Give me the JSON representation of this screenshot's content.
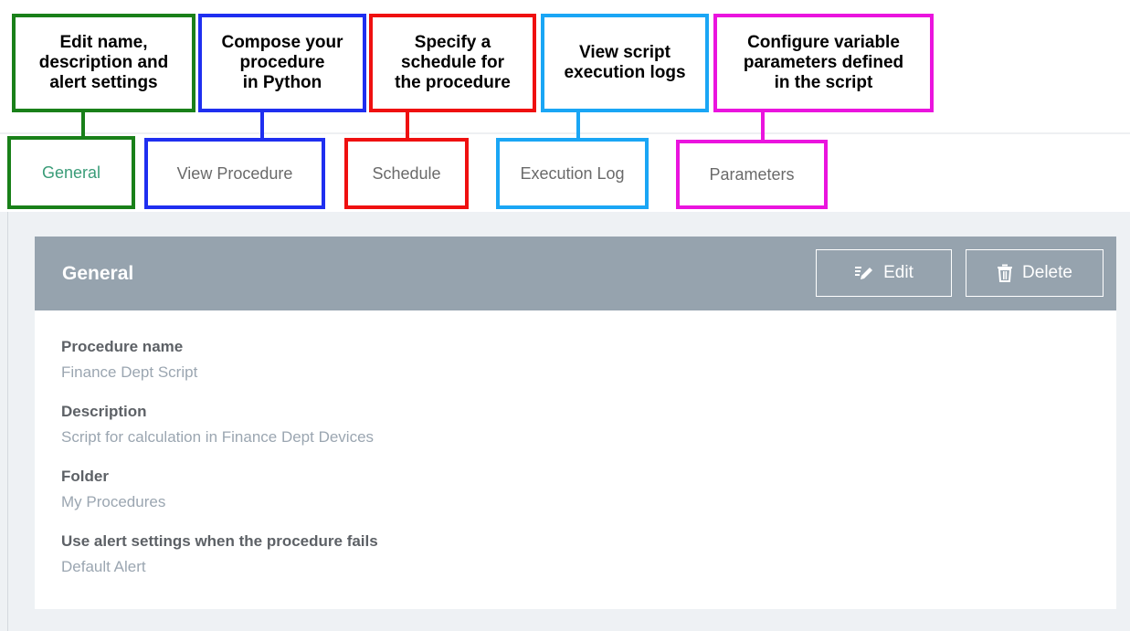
{
  "callouts": [
    {
      "id": "general",
      "text": "Edit name,\ndescription and\nalert settings",
      "color": "#198019"
    },
    {
      "id": "view-procedure",
      "text": "Compose your\nprocedure\nin Python",
      "color": "#1f2ff0"
    },
    {
      "id": "schedule",
      "text": "Specify a\nschedule for\nthe procedure",
      "color": "#ef1010"
    },
    {
      "id": "execution-log",
      "text": "View script\nexecution logs",
      "color": "#1aa6f5"
    },
    {
      "id": "parameters",
      "text": "Configure variable\nparameters defined\nin the script",
      "color": "#ea14de"
    }
  ],
  "tabs": [
    {
      "label": "General",
      "active": true
    },
    {
      "label": "View Procedure",
      "active": false
    },
    {
      "label": "Schedule",
      "active": false
    },
    {
      "label": "Execution Log",
      "active": false
    },
    {
      "label": "Parameters",
      "active": false
    }
  ],
  "card": {
    "title": "General",
    "edit_label": "Edit",
    "delete_label": "Delete",
    "fields": [
      {
        "label": "Procedure name",
        "value": "Finance Dept Script"
      },
      {
        "label": "Description",
        "value": "Script for calculation in Finance Dept Devices"
      },
      {
        "label": "Folder",
        "value": "My Procedures"
      },
      {
        "label": "Use alert settings when the procedure fails",
        "value": "Default Alert"
      }
    ]
  },
  "colors": {
    "active_tab_text": "#3a9c78",
    "header_bg": "#96a3ae",
    "page_bg": "#eef1f4",
    "label_text": "#5d6166",
    "value_text": "#9ba6b1"
  }
}
